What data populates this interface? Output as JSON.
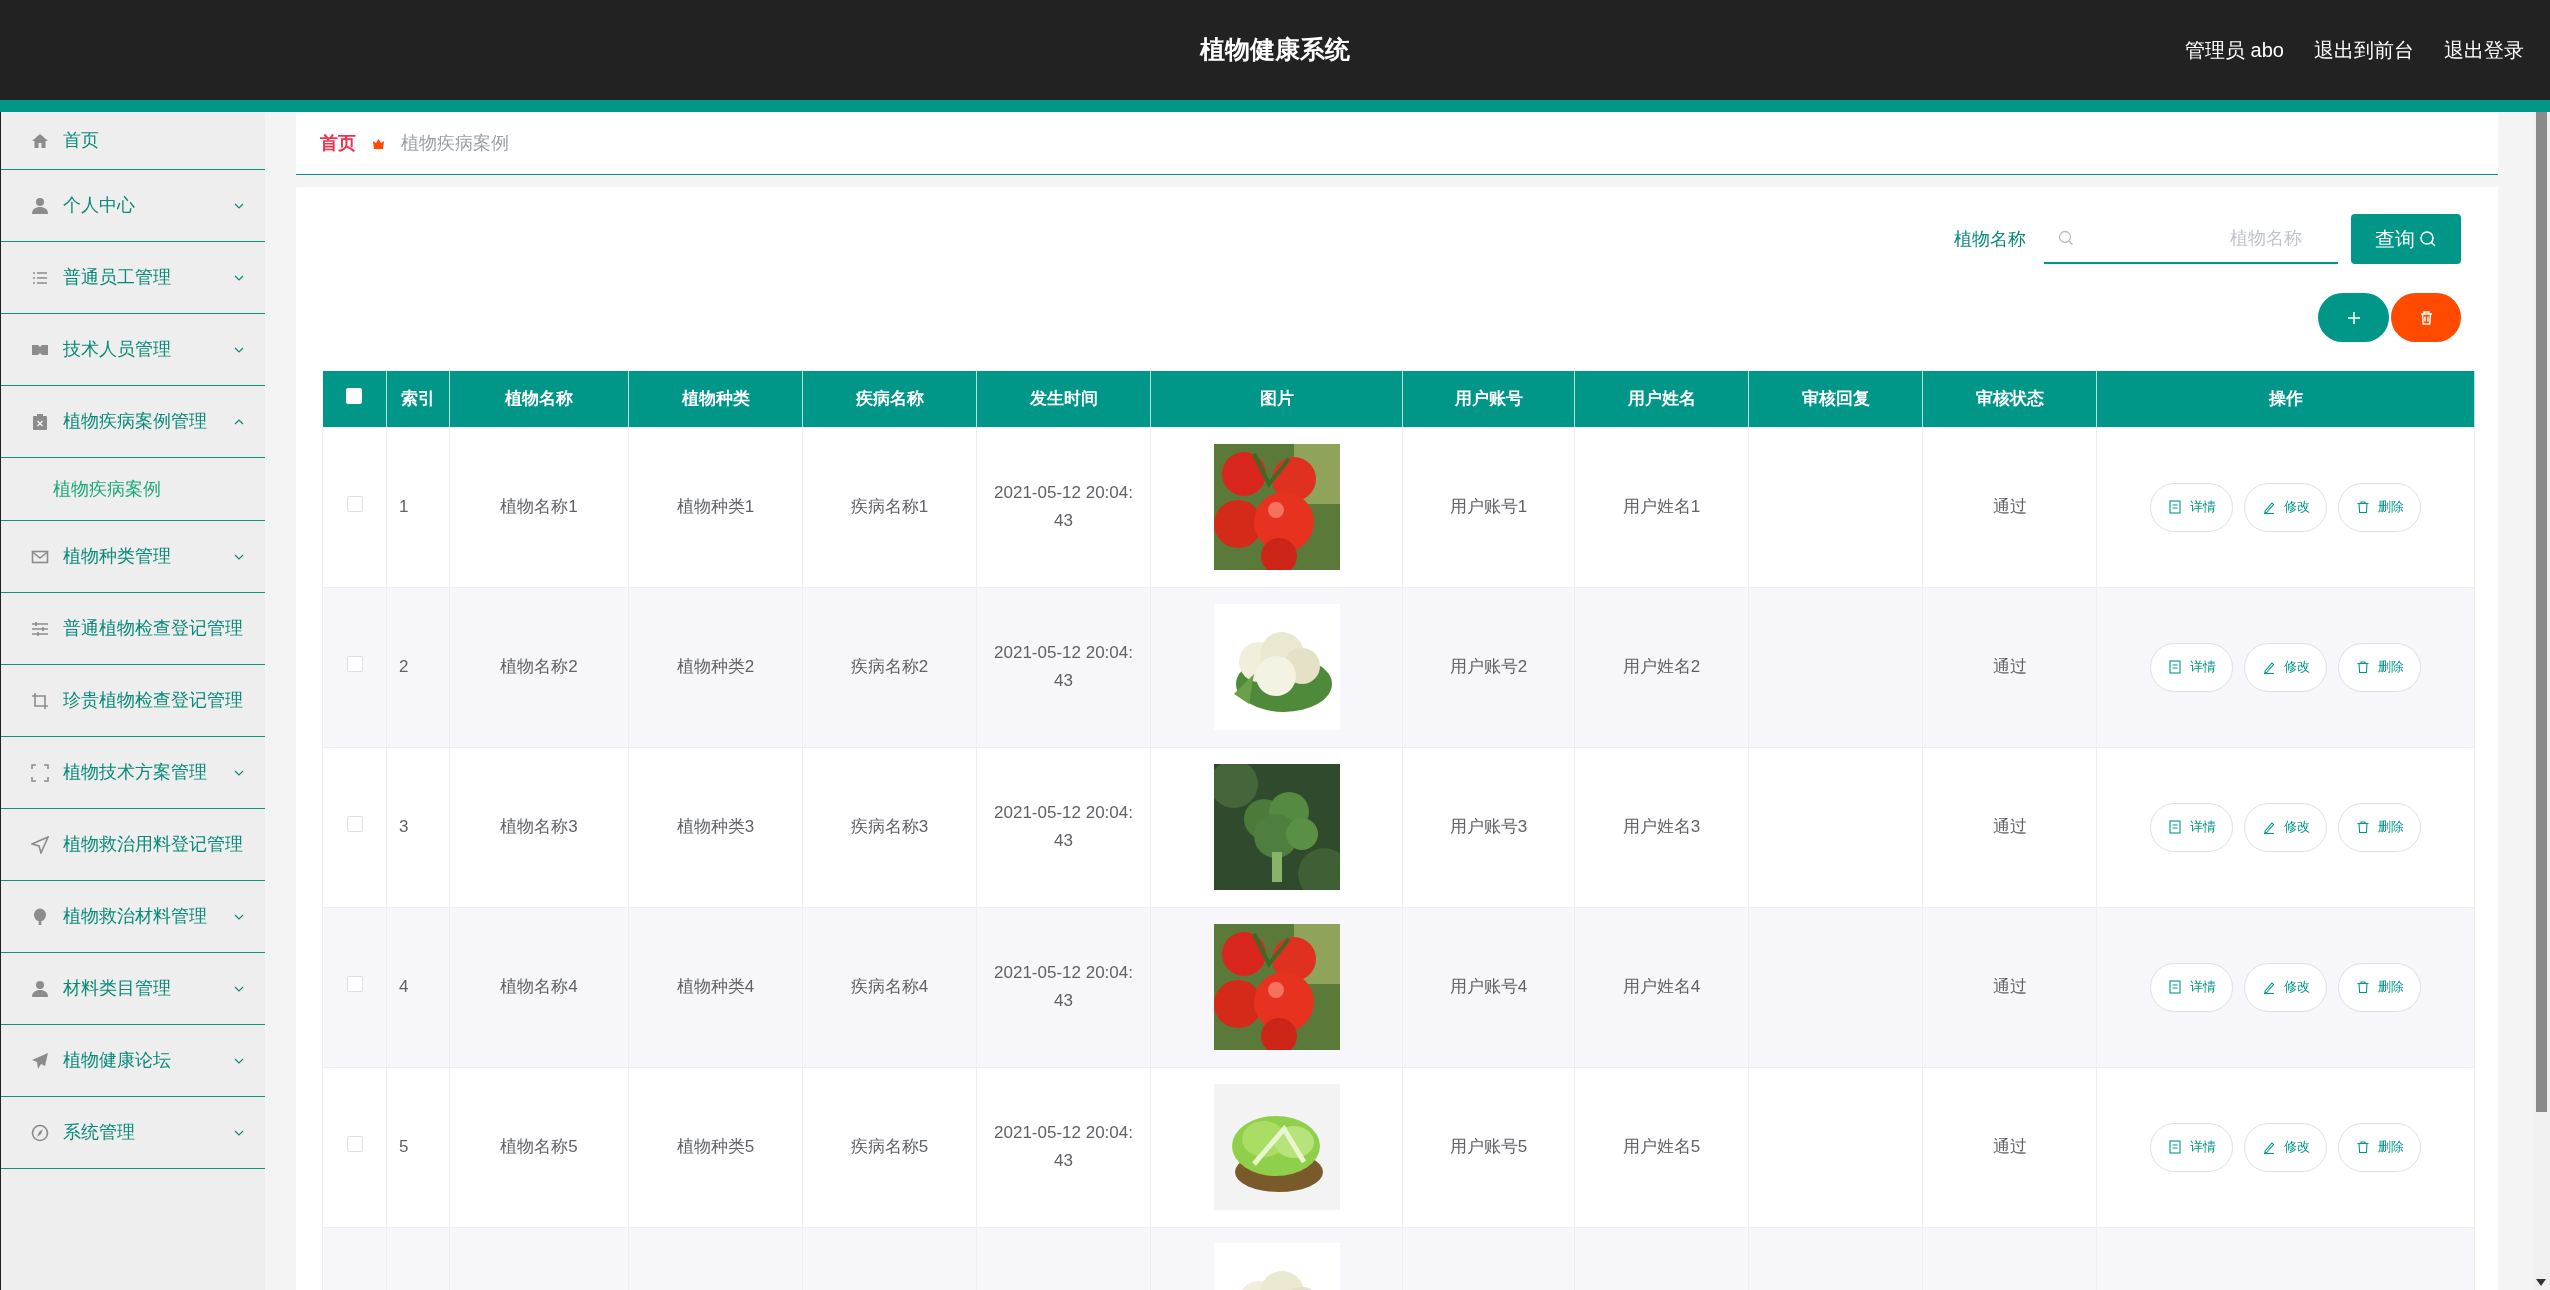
{
  "header": {
    "title": "植物健康系统",
    "links": [
      "管理员 abo",
      "退出到前台",
      "退出登录"
    ]
  },
  "sidebar": {
    "items": [
      {
        "label": "首页",
        "kind": "link"
      },
      {
        "label": "个人中心",
        "kind": "menu",
        "expanded": false
      },
      {
        "label": "普通员工管理",
        "kind": "menu",
        "expanded": false
      },
      {
        "label": "技术人员管理",
        "kind": "menu",
        "expanded": false
      },
      {
        "label": "植物疾病案例管理",
        "kind": "menu",
        "expanded": true,
        "children": [
          {
            "label": "植物疾病案例",
            "selected": true
          }
        ]
      },
      {
        "label": "植物种类管理",
        "kind": "menu",
        "expanded": false
      },
      {
        "label": "普通植物检查登记管理",
        "kind": "link"
      },
      {
        "label": "珍贵植物检查登记管理",
        "kind": "link"
      },
      {
        "label": "植物技术方案管理",
        "kind": "menu",
        "expanded": false
      },
      {
        "label": "植物救治用料登记管理",
        "kind": "link"
      },
      {
        "label": "植物救治材料管理",
        "kind": "menu",
        "expanded": false
      },
      {
        "label": "材料类目管理",
        "kind": "menu",
        "expanded": false
      },
      {
        "label": "植物健康论坛",
        "kind": "menu",
        "expanded": false
      },
      {
        "label": "系统管理",
        "kind": "menu",
        "expanded": false
      }
    ]
  },
  "breadcrumb": [
    "首页",
    "植物疾病案例"
  ],
  "search": {
    "label": "植物名称",
    "placeholder": "植物名称",
    "button": "查询"
  },
  "table": {
    "select_all": {
      "checked": false
    },
    "columns": [
      "索引",
      "植物名称",
      "植物种类",
      "疾病名称",
      "发生时间",
      "图片",
      "用户账号",
      "用户姓名",
      "审核回复",
      "审核状态",
      "操作"
    ],
    "rows": [
      {
        "checked": false,
        "index": "1",
        "plant_name": "植物名称1",
        "plant_type": "植物种类1",
        "disease": "疾病名称1",
        "time": "2021-05-12 20:04:43",
        "image": {
          "kind": "picture"
        },
        "account": "用户账号1",
        "user": "用户姓名1",
        "status": "通过",
        "actions": [
          "详情",
          "修改",
          "删除"
        ]
      },
      {
        "checked": false,
        "index": "2",
        "plant_name": "植物名称2",
        "plant_type": "植物种类2",
        "disease": "疾病名称2",
        "time": "2021-05-12 20:04:43",
        "image": {
          "kind": "picture"
        },
        "account": "用户账号2",
        "user": "用户姓名2",
        "status": "通过",
        "actions": [
          "详情",
          "修改",
          "删除"
        ]
      },
      {
        "checked": false,
        "index": "3",
        "plant_name": "植物名称3",
        "plant_type": "植物种类3",
        "disease": "疾病名称3",
        "time": "2021-05-12 20:04:43",
        "image": {
          "kind": "picture"
        },
        "account": "用户账号3",
        "user": "用户姓名3",
        "status": "通过",
        "actions": [
          "详情",
          "修改",
          "删除"
        ]
      },
      {
        "checked": false,
        "index": "4",
        "plant_name": "植物名称4",
        "plant_type": "植物种类4",
        "disease": "疾病名称4",
        "time": "2021-05-12 20:04:43",
        "image": {
          "kind": "picture"
        },
        "account": "用户账号4",
        "user": "用户姓名4",
        "status": "通过",
        "actions": [
          "详情",
          "修改",
          "删除"
        ]
      },
      {
        "checked": false,
        "index": "5",
        "plant_name": "植物名称5",
        "plant_type": "植物种类5",
        "disease": "疾病名称5",
        "time": "2021-05-12 20:04:43",
        "image": {
          "kind": "picture"
        },
        "account": "用户账号5",
        "user": "用户姓名5",
        "status": "通过",
        "actions": [
          "详情",
          "修改",
          "删除"
        ]
      },
      {
        "image": {
          "kind": "picture"
        }
      }
    ]
  }
}
